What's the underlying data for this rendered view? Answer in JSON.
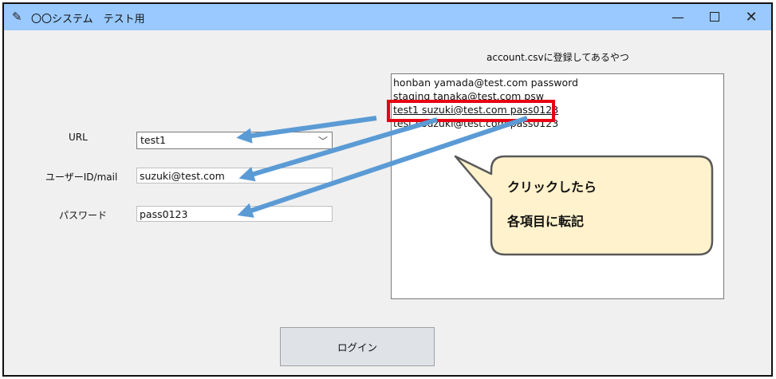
{
  "window": {
    "title": "〇〇システム　テスト用",
    "minimize": "—",
    "close": "✕"
  },
  "form": {
    "url_label": "URL",
    "url_value": "test1",
    "user_label": "ユーザーID/mail",
    "user_value": "suzuki@test.com",
    "password_label": "パスワード",
    "password_value": "pass0123"
  },
  "account_list": {
    "caption": "account.csvに登録してあるやつ",
    "items": [
      "honban yamada@test.com password",
      "staging tanaka@test.com psw",
      "test1 suzuki@test.com pass0123",
      "test2 suzuki@test.com pass0123"
    ],
    "selected_index": 2
  },
  "login_button": "ログイン",
  "annotation": {
    "line1": "クリックしたら",
    "line2": "各項目に転記",
    "highlight_color": "#e60012",
    "arrow_color": "#5b9bd5",
    "callout_fill": "#fff2cc",
    "callout_stroke": "#595959"
  }
}
